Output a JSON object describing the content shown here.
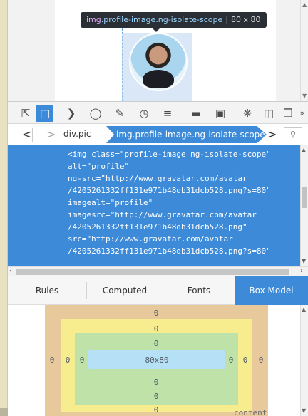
{
  "preview": {
    "tooltip": {
      "tag": "img",
      "classes": ".profile-image.ng-isolate-scope",
      "dimensions": "80 x 80"
    },
    "avatar": "profile-photo"
  },
  "toolbar": {
    "icons": [
      "pick-element-icon",
      "responsive-mode-icon",
      "console-icon",
      "debugger-icon",
      "style-editor-icon",
      "performance-icon",
      "network-icon",
      "storage-icon",
      "scratchpad-icon",
      "settings-icon",
      "dock-icon",
      "split-console-icon",
      "more-icon"
    ]
  },
  "breadcrumbs": {
    "back": "<",
    "forward": ">",
    "items": [
      "div.pic",
      "img.profile-image.ng-isolate-scope"
    ],
    "next": ">",
    "search_icon": "search-icon"
  },
  "markup": {
    "lines": [
      "<img class=\"profile-image ng-isolate-scope\"",
      "alt=\"profile\"",
      "ng-src=\"http://www.gravatar.com/avatar",
      "/4205261332ff131e971b48db31dcb528.png?s=80\"",
      "imagealt=\"profile\"",
      "imagesrc=\"http://www.gravatar.com/avatar",
      "/4205261332ff131e971b48db31dcb528.png\"",
      "src=\"http://www.gravatar.com/avatar",
      "/4205261332ff131e971b48db31dcb528.png?s=80\""
    ]
  },
  "tabs": [
    "Rules",
    "Computed",
    "Fonts",
    "Box Model"
  ],
  "active_tab": "Box Model",
  "box_model": {
    "margin": {
      "top": "0",
      "right": "0",
      "bottom": "0",
      "left": "0"
    },
    "border": {
      "top": "0",
      "right": "0",
      "bottom": "0",
      "left": "0"
    },
    "padding": {
      "top": "0",
      "right": "0",
      "bottom": "0",
      "left": "0"
    },
    "content": "80x80",
    "caption": "content"
  },
  "colors": {
    "accent": "#3d8bd8",
    "margin": "#e7c99c",
    "border": "#f7ec8e",
    "padding": "#bfe2a8",
    "content": "#b6e0f5"
  }
}
